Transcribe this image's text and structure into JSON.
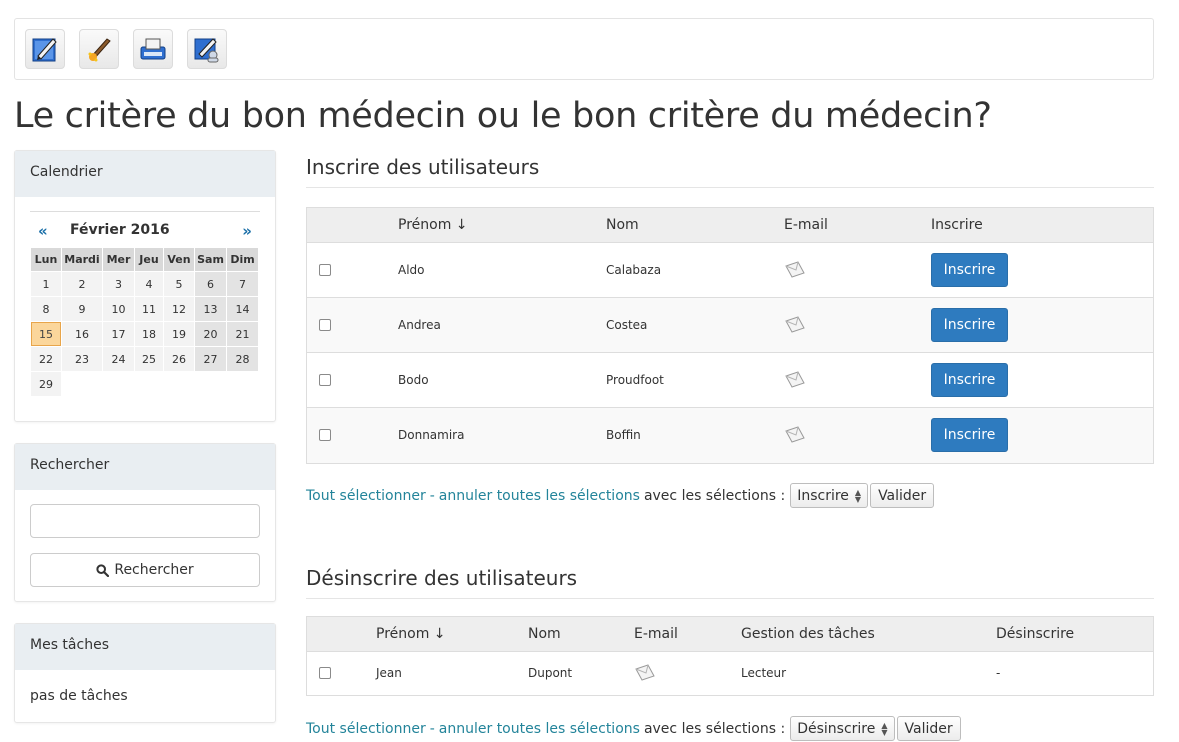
{
  "toolbar": {
    "buttons": [
      {
        "name": "edit-icon"
      },
      {
        "name": "brush-icon"
      },
      {
        "name": "typewriter-icon"
      },
      {
        "name": "edit-user-icon"
      }
    ]
  },
  "page_title": "Le critère du bon médecin ou le bon critère du médecin?",
  "calendar": {
    "title": "Calendrier",
    "prev": "«",
    "next": "»",
    "month": "Février 2016",
    "days": [
      "Lun",
      "Mardi",
      "Mer",
      "Jeu",
      "Ven",
      "Sam",
      "Dim"
    ],
    "weeks": [
      [
        "1",
        "2",
        "3",
        "4",
        "5",
        "6",
        "7"
      ],
      [
        "8",
        "9",
        "10",
        "11",
        "12",
        "13",
        "14"
      ],
      [
        "15",
        "16",
        "17",
        "18",
        "19",
        "20",
        "21"
      ],
      [
        "22",
        "23",
        "24",
        "25",
        "26",
        "27",
        "28"
      ],
      [
        "29",
        "",
        "",
        "",
        "",
        "",
        ""
      ]
    ],
    "today": "15"
  },
  "search": {
    "title": "Rechercher",
    "input_value": "",
    "button_label": "Rechercher"
  },
  "tasks": {
    "title": "Mes tâches",
    "empty_text": "pas de tâches"
  },
  "enrol": {
    "title": "Inscrire des utilisateurs",
    "columns": {
      "firstname": "Prénom ↓",
      "lastname": "Nom",
      "email": "E-mail",
      "action": "Inscrire"
    },
    "rows": [
      {
        "firstname": "Aldo",
        "lastname": "Calabaza",
        "action": "Inscrire"
      },
      {
        "firstname": "Andrea",
        "lastname": "Costea",
        "action": "Inscrire"
      },
      {
        "firstname": "Bodo",
        "lastname": "Proudfoot",
        "action": "Inscrire"
      },
      {
        "firstname": "Donnamira",
        "lastname": "Boffin",
        "action": "Inscrire"
      }
    ],
    "select_all": "Tout sélectionner",
    "separator": "-",
    "unselect_all": "annuler toutes les sélections",
    "with_selection": "avec les sélections :",
    "select_value": "Inscrire",
    "validate": "Valider"
  },
  "unenrol": {
    "title": "Désinscrire des utilisateurs",
    "columns": {
      "firstname": "Prénom ↓",
      "lastname": "Nom",
      "email": "E-mail",
      "tasks": "Gestion des tâches",
      "action": "Désinscrire"
    },
    "rows": [
      {
        "firstname": "Jean",
        "lastname": "Dupont",
        "tasks": "Lecteur",
        "action": "-"
      }
    ],
    "select_all": "Tout sélectionner",
    "separator": "-",
    "unselect_all": "annuler toutes les sélections",
    "with_selection": "avec les sélections :",
    "select_value": "Désinscrire",
    "validate": "Valider"
  },
  "colors": {
    "primary_button": "#2e7bbf",
    "link": "#23849a",
    "today_highlight": "#fbd69b"
  }
}
